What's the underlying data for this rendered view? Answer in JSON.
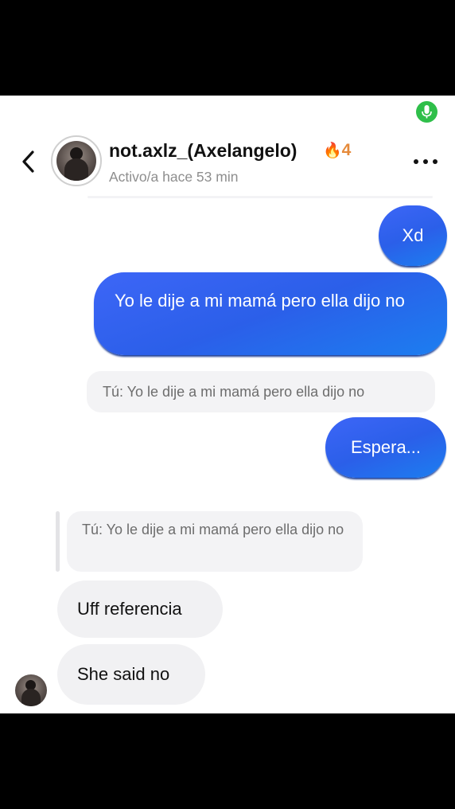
{
  "header": {
    "name": "not.axlz_(Axelangelo)",
    "streak_icon": "flame-icon",
    "streak_count": "4",
    "status": "Activo/a hace 53 min"
  },
  "messages": {
    "xd": "Xd",
    "yo": "Yo le dije a mi mamá pero ella dijo no",
    "reply_1": "Tú: Yo le dije a mi mamá pero ella dijo no",
    "espera": "Espera...",
    "reply_2": "Tú: Yo le dije a mi mamá pero ella dijo no",
    "uff": "Uff referencia",
    "she": "She said no"
  },
  "colors": {
    "sent_bubble": "#2b5fe9",
    "received_bubble": "#f1f1f3",
    "streak": "#e58a3a",
    "mic_indicator": "#2fbf4a"
  }
}
